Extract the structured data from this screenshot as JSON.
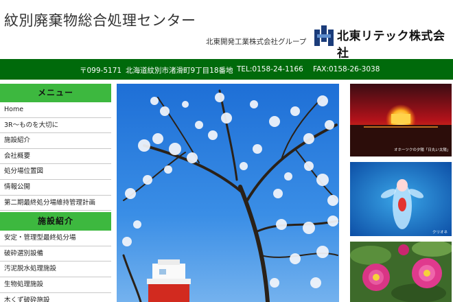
{
  "header": {
    "site_title": "紋別廃棄物総合処理センター",
    "group_text": "北東開発工業株式会社グループ",
    "company_name": "北東リテック株式会社"
  },
  "info_bar": {
    "postal": "〒099-5171",
    "address": "北海道紋別市渚滑町9丁目18番地",
    "tel": "TEL:0158-24-1166",
    "fax": "FAX:0158-26-3038"
  },
  "sidebar": {
    "menu_heading": "メニュー",
    "menu_items": [
      "Home",
      "3R〜ものを大切に",
      "施設紹介",
      "会社概要",
      "処分場位置図",
      "情報公開",
      "第二期最終処分場維持管理計画"
    ],
    "facility_heading": "施設紹介",
    "facility_items": [
      "安定・管理型最終処分場",
      "破砕選別設備",
      "汚泥脱水処理施設",
      "生物処理施設",
      "木くず破砕施設"
    ]
  },
  "thumbs": {
    "sunset_caption": "オホーツクの夕陽「日丸い太陽」",
    "clione_caption": "クリオネ"
  },
  "colors": {
    "info_bar": "#006a0b",
    "side_heading": "#3db83f"
  }
}
